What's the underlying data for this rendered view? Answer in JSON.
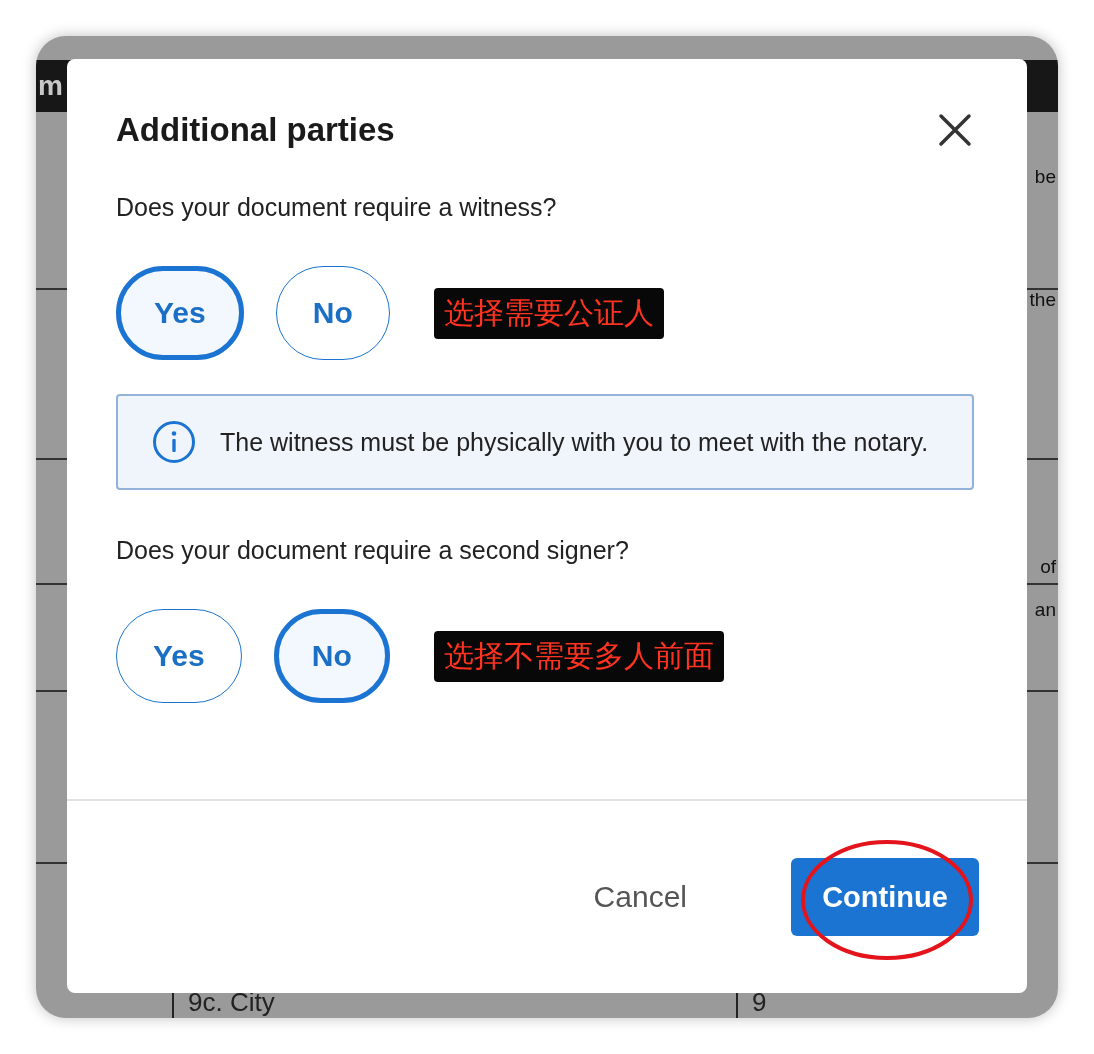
{
  "background": {
    "header_text": "m",
    "fragments": [
      "be",
      "the",
      "of",
      "an"
    ],
    "bottom_cells": [
      "9c. City",
      "9"
    ]
  },
  "dialog": {
    "title": "Additional parties",
    "questions": [
      {
        "text": "Does your document require a witness?",
        "options": [
          {
            "label": "Yes",
            "selected": true
          },
          {
            "label": "No",
            "selected": false
          }
        ],
        "annotation": "选择需要公证人",
        "info": "The witness must be physically with you to meet with the notary."
      },
      {
        "text": "Does your document require a second signer?",
        "options": [
          {
            "label": "Yes",
            "selected": false
          },
          {
            "label": "No",
            "selected": true
          }
        ],
        "annotation": "选择不需要多人前面"
      }
    ],
    "cancel": "Cancel",
    "continue": {
      "label": "Continue",
      "highlighted": true
    }
  }
}
